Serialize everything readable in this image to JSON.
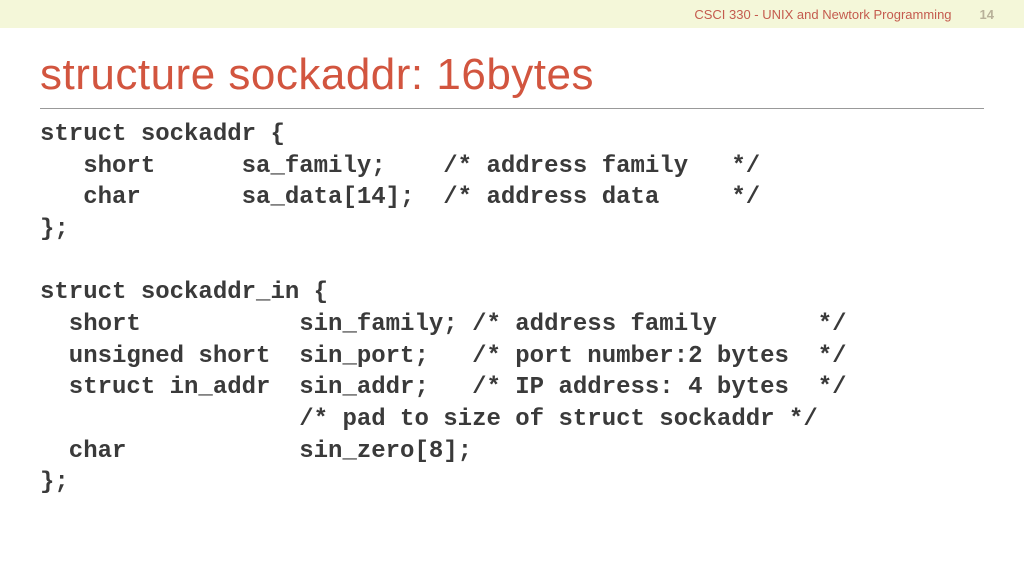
{
  "header": {
    "course": "CSCI 330 - UNIX and Newtork Programming",
    "page": "14"
  },
  "title": "structure sockaddr: 16bytes",
  "code": "struct sockaddr {\n   short      sa_family;    /* address family   */\n   char       sa_data[14];  /* address data     */\n};\n\nstruct sockaddr_in {\n  short           sin_family; /* address family       */\n  unsigned short  sin_port;   /* port number:2 bytes  */\n  struct in_addr  sin_addr;   /* IP address: 4 bytes  */\n                  /* pad to size of struct sockaddr */\n  char            sin_zero[8];\n};"
}
